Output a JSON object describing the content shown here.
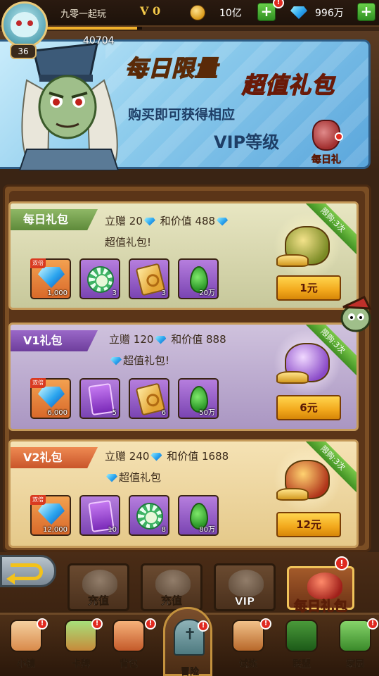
{
  "player": {
    "name": "九零一起玩",
    "level": "36",
    "vip": "V 0",
    "power": "40704",
    "xp_fraction": 0.95
  },
  "currency": {
    "gold": "10亿",
    "gems": "996万"
  },
  "banner": {
    "title_line1": "每日限量",
    "title_line2": "超值礼包",
    "subtitle1": "购买即可获得相应",
    "subtitle2": "VIP等级",
    "daily_gift_label": "每日礼"
  },
  "packs": [
    {
      "title": "每日礼包",
      "desc_prefix": "立赠",
      "gift_gems": "20",
      "desc_mid": "和价值",
      "value_gems": "488",
      "desc_suffix": "超值礼包!",
      "price": "1元",
      "limit": "限购:3次",
      "items": [
        {
          "icon": "gem-icon",
          "count": "1,000",
          "double_tag": "双倍"
        },
        {
          "icon": "chip-icon",
          "count": "3"
        },
        {
          "icon": "card-icon",
          "count": "3"
        },
        {
          "icon": "seed-icon",
          "count": "20万"
        }
      ]
    },
    {
      "title": "V1礼包",
      "desc_prefix": "立赠",
      "gift_gems": "120",
      "desc_mid": "和价值",
      "value_gems": "888",
      "desc_suffix": "超值礼包!",
      "price": "6元",
      "limit": "限购:3次",
      "items": [
        {
          "icon": "gem-icon",
          "count": "6,000",
          "double_tag": "双倍"
        },
        {
          "icon": "vip-card-icon",
          "count": "5"
        },
        {
          "icon": "card-icon",
          "count": "6"
        },
        {
          "icon": "seed-icon",
          "count": "50万"
        }
      ]
    },
    {
      "title": "V2礼包",
      "desc_prefix": "立赠",
      "gift_gems": "240",
      "desc_mid": "和价值",
      "value_gems": "1688",
      "desc_suffix": "超值礼包",
      "price": "12元",
      "limit": "限购:3次",
      "items": [
        {
          "icon": "gem-icon",
          "count": "12,000",
          "double_tag": "双倍"
        },
        {
          "icon": "vip-card-icon",
          "count": "10"
        },
        {
          "icon": "chip-icon",
          "count": "8"
        },
        {
          "icon": "seed-icon",
          "count": "80万"
        }
      ]
    }
  ],
  "tabs": [
    {
      "label": "充值"
    },
    {
      "label": "充值"
    },
    {
      "label": "VIP"
    },
    {
      "label": "每日礼包"
    }
  ],
  "nav": [
    {
      "label": "小镇"
    },
    {
      "label": "卡牌"
    },
    {
      "label": "背包"
    },
    {
      "label": "冒险"
    },
    {
      "label": "试炼"
    },
    {
      "label": "联盟"
    },
    {
      "label": "家园"
    }
  ],
  "badge_mark": "!",
  "colors": {
    "accent_gold": "#f2a81c",
    "green_pack": "#8fb866",
    "purple_pack": "#9a68c8",
    "orange_pack": "#ee8a52",
    "alert_red": "#e02a20"
  }
}
